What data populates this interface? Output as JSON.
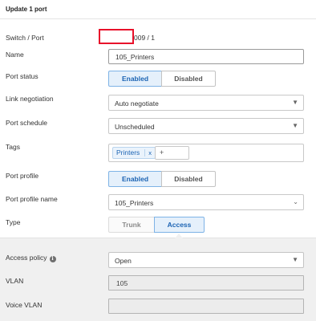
{
  "header": {
    "title": "Update 1 port"
  },
  "switch_port": {
    "label": "Switch / Port",
    "value": "009 / 1"
  },
  "name": {
    "label": "Name",
    "value": "105_Printers"
  },
  "port_status": {
    "label": "Port status",
    "options": [
      "Enabled",
      "Disabled"
    ],
    "selected": "Enabled"
  },
  "link_negotiation": {
    "label": "Link negotiation",
    "value": "Auto negotiate"
  },
  "port_schedule": {
    "label": "Port schedule",
    "value": "Unscheduled"
  },
  "tags": {
    "label": "Tags",
    "items": [
      {
        "label": "Printers",
        "remove": "x"
      }
    ],
    "add_label": "+"
  },
  "port_profile": {
    "label": "Port profile",
    "options": [
      "Enabled",
      "Disabled"
    ],
    "selected": "Enabled"
  },
  "port_profile_name": {
    "label": "Port profile name",
    "value": "105_Printers"
  },
  "type": {
    "label": "Type",
    "options": [
      "Trunk",
      "Access"
    ],
    "selected": "Access"
  },
  "access_policy": {
    "label": "Access policy",
    "value": "Open",
    "info_icon": "info-circle-icon"
  },
  "vlan": {
    "label": "VLAN",
    "value": "105"
  },
  "voice_vlan": {
    "label": "Voice VLAN",
    "value": ""
  },
  "colors": {
    "accent": "#1b63b3",
    "active_bg": "#e5f0fb",
    "redaction": "#e8102a",
    "section_bg": "#f0f0f0"
  }
}
